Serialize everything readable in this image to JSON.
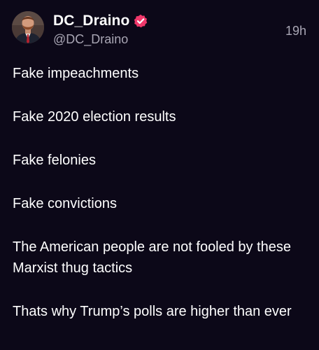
{
  "author": {
    "display_name": "DC_Draino",
    "handle": "@DC_Draino",
    "avatar_icon": "profile-photo",
    "verified_icon": "verified-badge-icon",
    "verified_color": "#f0386b"
  },
  "post": {
    "timestamp": "19h",
    "paragraphs": [
      "Fake impeachments",
      "Fake 2020 election results",
      "Fake felonies",
      "Fake convictions",
      "The American people are not fooled by these Marxist thug tactics",
      "Thats why Trump’s polls are higher than ever"
    ]
  },
  "colors": {
    "background": "#0c0818",
    "text": "#ffffff",
    "secondary_text": "#a9a6b4"
  }
}
